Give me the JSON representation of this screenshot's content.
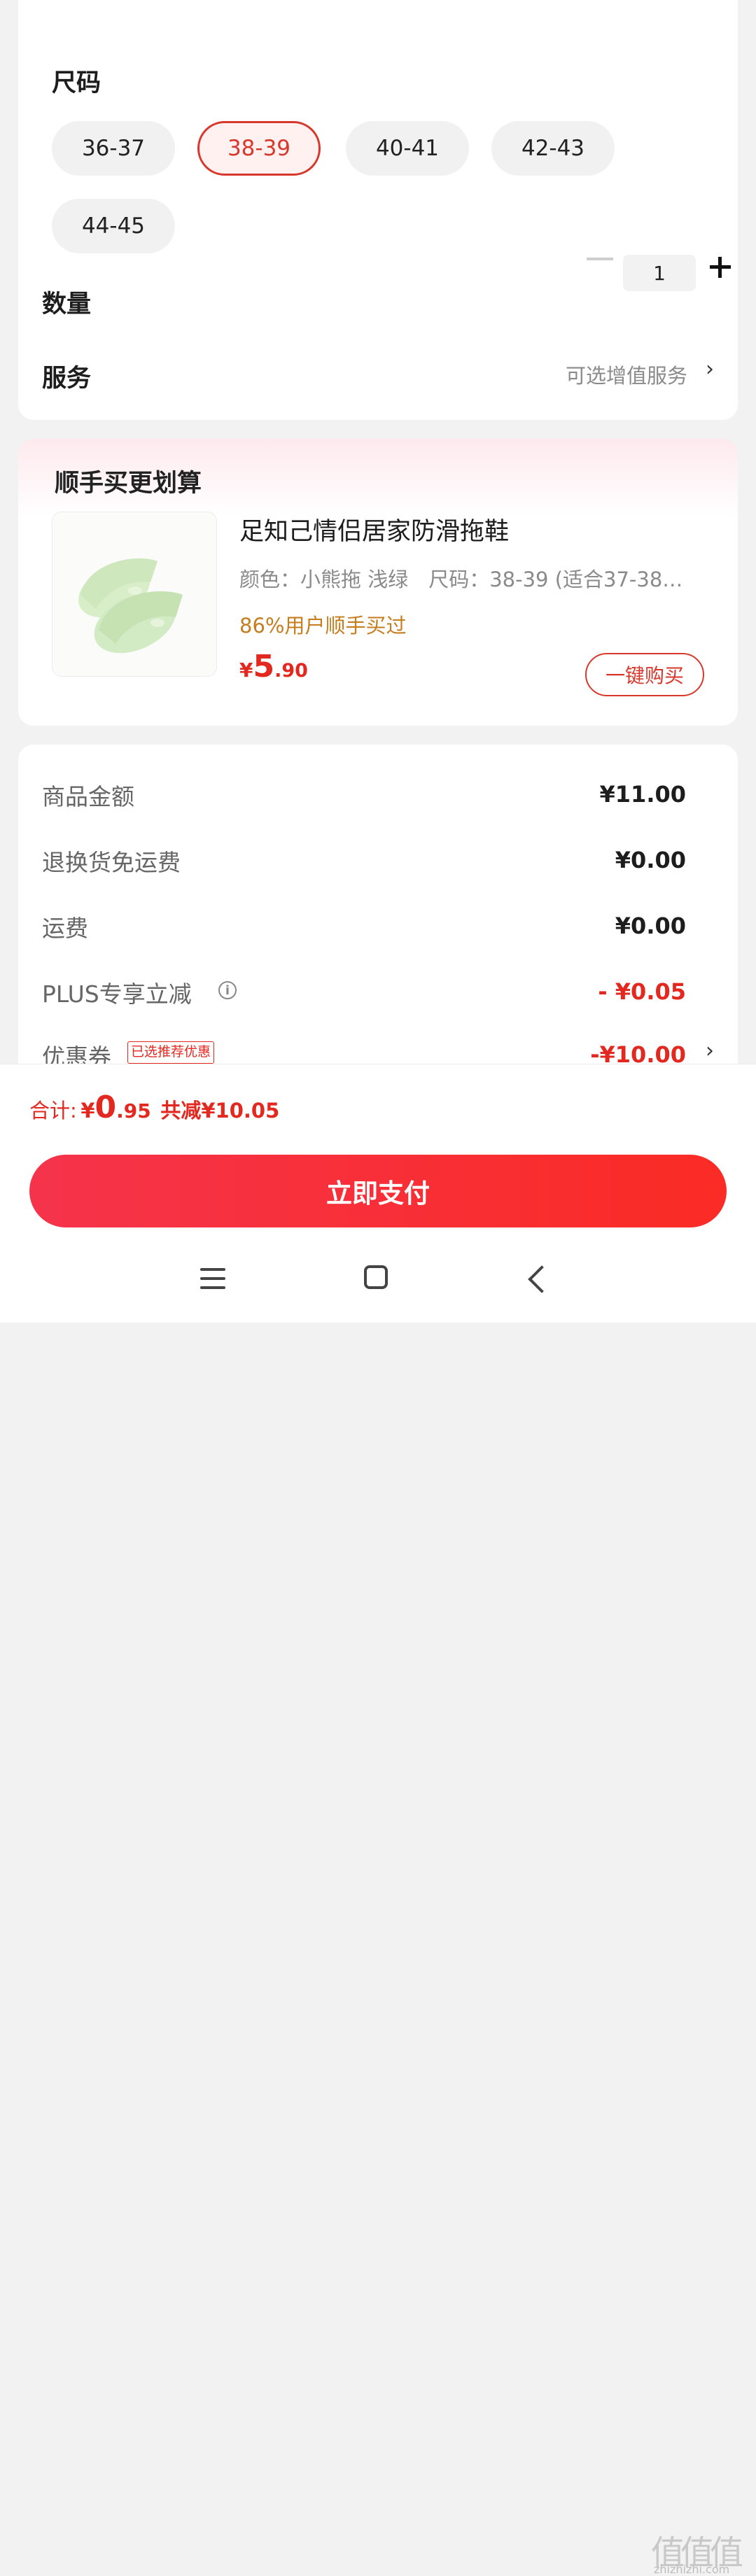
{
  "spec": {
    "size_label": "尺码",
    "sizes": [
      "36-37",
      "38-39",
      "40-41",
      "42-43",
      "44-45"
    ],
    "selected_size": "38-39",
    "quantity_label": "数量",
    "quantity_value": "1",
    "service_label": "服务",
    "service_value": "可选增值服务",
    "chevron": "›"
  },
  "recommend": {
    "title": "顺手买更划算",
    "product_name": "足知己情侣居家防滑拖鞋",
    "product_spec": "颜色：小熊拖 浅绿　尺码：38-39 (适合37-38…",
    "social_note": "86%用户顺手买过",
    "price_currency": "¥",
    "price_int": "5",
    "price_dec": ".90",
    "buy_button": "一键购买",
    "image_icon": "slipper-image"
  },
  "summary": {
    "rows": [
      {
        "label": "商品金额",
        "value": "¥11.00"
      },
      {
        "label": "退换货免运费",
        "value": "¥0.00"
      },
      {
        "label": "运费",
        "value": "¥0.00"
      },
      {
        "label": "PLUS专享立减",
        "value": "- ¥0.05"
      },
      {
        "label": "优惠券",
        "value": "-¥10.00"
      }
    ],
    "coupon_badge": "已选推荐优惠",
    "info_glyph": "i"
  },
  "total": {
    "label": "合计:",
    "currency": "¥",
    "int": "0",
    "dec": ".95",
    "saved": "共减¥10.05"
  },
  "pay_button": "立即支付",
  "watermark": {
    "glyphs": "值值值",
    "url": "zhizhizhi.com"
  },
  "colors": {
    "accent": "#e3281f",
    "note": "#c67d1e",
    "pay_gradient_start": "#f5334b",
    "pay_gradient_end": "#fb2b25"
  }
}
